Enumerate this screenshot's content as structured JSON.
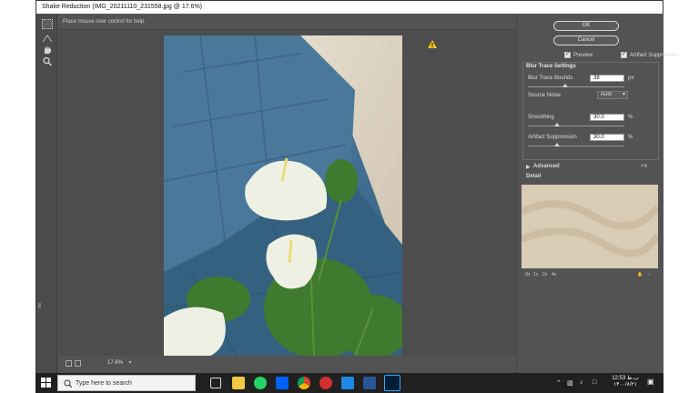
{
  "window": {
    "title": "Shake Reduction (IMG_20211110_231558.jpg @ 17.6%)",
    "help_text": "Place mouse over control for help."
  },
  "tools": [
    {
      "name": "blur-estimation-tool",
      "icon": "dotted-rect-icon"
    },
    {
      "name": "blur-direction-tool",
      "icon": "blur-direction-icon"
    },
    {
      "name": "hand-tool",
      "icon": "hand-icon"
    },
    {
      "name": "zoom-tool",
      "icon": "magnifier-icon"
    }
  ],
  "canvas": {
    "zoom": "17.6%",
    "warning_icon": "warning-icon"
  },
  "panel": {
    "ok": "OK",
    "cancel": "Cancel",
    "preview": {
      "label": "Preview",
      "checked": true
    },
    "artifact_suppression_check": {
      "label": "Artifact Suppression",
      "checked": true
    },
    "blur_trace_settings": "Blur Trace Settings",
    "blur_trace_bounds": {
      "label": "Blur Trace Bounds",
      "value": "38",
      "unit": "px"
    },
    "source_noise": {
      "label": "Source Noise",
      "value": "Auto"
    },
    "smoothing": {
      "label": "Smoothing",
      "value": "30.0",
      "unit": "%"
    },
    "artifact_suppression": {
      "label": "Artifact Suppression",
      "value": "30.0",
      "unit": "%"
    },
    "advanced": "Advanced",
    "detail": "Detail",
    "zoom_buttons": [
      ".5x",
      "1x",
      "2x",
      "4x"
    ]
  },
  "taskbar": {
    "search_placeholder": "Type here to search",
    "time": "12:53",
    "time_suffix": "ب.ظ",
    "date": "۱۴۰۰/۸/۲۱",
    "colors": {
      "bar": "#202020",
      "accent": "#0078d7"
    }
  }
}
